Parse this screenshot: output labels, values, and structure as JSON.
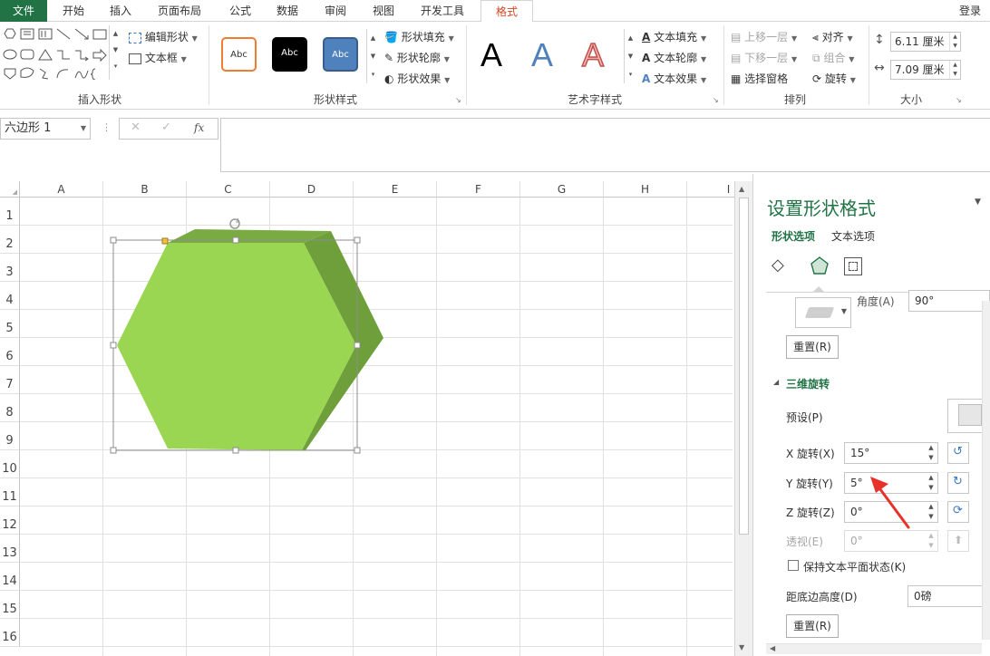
{
  "tabs": [
    "文件",
    "开始",
    "插入",
    "页面布局",
    "公式",
    "数据",
    "审阅",
    "视图",
    "开发工具",
    "格式"
  ],
  "login": "登录",
  "ribbon": {
    "insert_shapes": {
      "label": "插入形状",
      "edit_shape": "编辑形状",
      "text_box": "文本框"
    },
    "shape_styles": {
      "label": "形状样式",
      "sample": "Abc",
      "fill": "形状填充",
      "outline": "形状轮廓",
      "effects": "形状效果",
      "colors": [
        "#ed7d31",
        "#000000",
        "#4f81bd"
      ]
    },
    "wordart": {
      "label": "艺术字样式",
      "letter": "A",
      "text_fill": "文本填充",
      "text_outline": "文本轮廓",
      "text_effects": "文本效果"
    },
    "arrange": {
      "label": "排列",
      "bring_forward": "上移一层",
      "send_backward": "下移一层",
      "selection_pane": "选择窗格",
      "align": "对齐",
      "group": "组合",
      "rotate": "旋转"
    },
    "size": {
      "label": "大小",
      "height": "6.11 厘米",
      "width": "7.09 厘米"
    }
  },
  "formula_bar": {
    "name_box": "六边形 1",
    "fx": "fx"
  },
  "sheet": {
    "columns": [
      "A",
      "B",
      "C",
      "D",
      "E",
      "F",
      "G",
      "H",
      "I"
    ],
    "rows": [
      "1",
      "2",
      "3",
      "4",
      "5",
      "6",
      "7",
      "8",
      "9",
      "10",
      "11",
      "12",
      "13",
      "14",
      "15",
      "16"
    ],
    "shape": {
      "front_color": "#9ad651",
      "side_color": "#6e9f3a",
      "top_color": "#7aab43",
      "x_rotation_deg": 15,
      "y_rotation_deg": 5
    }
  },
  "pane": {
    "title": "设置形状格式",
    "tab_shape_options": "形状选项",
    "tab_text_options": "文本选项",
    "angle_label": "角度(A)",
    "angle_value": "90°",
    "reset_top": "重置(R)",
    "section_3d": "三维旋转",
    "preset_label": "预设(P)",
    "x_rot_label": "X 旋转(X)",
    "x_rot_value": "15°",
    "y_rot_label": "Y 旋转(Y)",
    "y_rot_value": "5°",
    "z_rot_label": "Z 旋转(Z)",
    "z_rot_value": "0°",
    "persp_label": "透视(E)",
    "persp_value": "0°",
    "keep_text_flat": "保持文本平面状态(K)",
    "distance_label": "距底边高度(D)",
    "distance_value": "0磅",
    "reset_bottom": "重置(R)",
    "arrow_color": "#e8312b"
  }
}
